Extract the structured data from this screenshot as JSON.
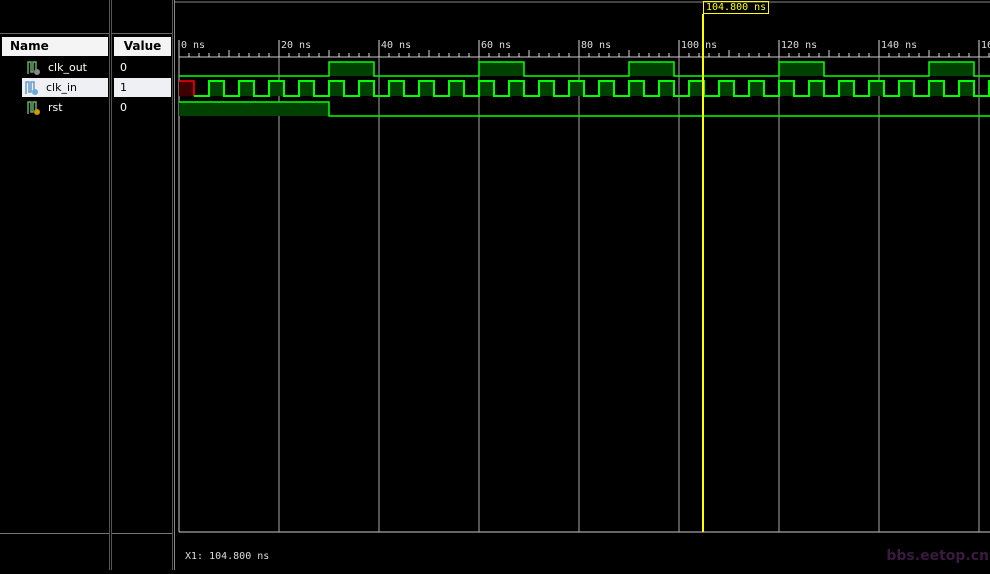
{
  "columns": {
    "name": "Name",
    "value": "Value"
  },
  "signals": [
    {
      "name": "clk_out",
      "value": "0",
      "icon": "clock-signal-icon"
    },
    {
      "name": "clk_in",
      "value": "1",
      "icon": "input-signal-icon"
    },
    {
      "name": "rst",
      "value": "0",
      "icon": "input-signal-icon"
    }
  ],
  "timeline": {
    "unit": "ns",
    "labels": [
      "0 ns",
      "20 ns",
      "40 ns",
      "60 ns",
      "80 ns",
      "100 ns",
      "120 ns",
      "140 ns",
      "16"
    ]
  },
  "cursor": {
    "label": "104.800 ns",
    "time_ns": 104.8
  },
  "status": {
    "x1": "X1: 104.800 ns"
  },
  "watermark": "bbs.eetop.cn",
  "waveforms": {
    "clk_out": {
      "high": [
        [
          30,
          39
        ],
        [
          60,
          69
        ],
        [
          90,
          99
        ],
        [
          120,
          129
        ],
        [
          150,
          159
        ]
      ]
    },
    "clk_in": {
      "undefined_until": 3,
      "period": 6,
      "first_rise": 6
    },
    "rst": {
      "high": [
        [
          0,
          30
        ]
      ]
    }
  },
  "colors": {
    "wave": "#00ff00",
    "fill": "#004000",
    "cursor": "#ffff00",
    "undefined": "#ff0000"
  }
}
